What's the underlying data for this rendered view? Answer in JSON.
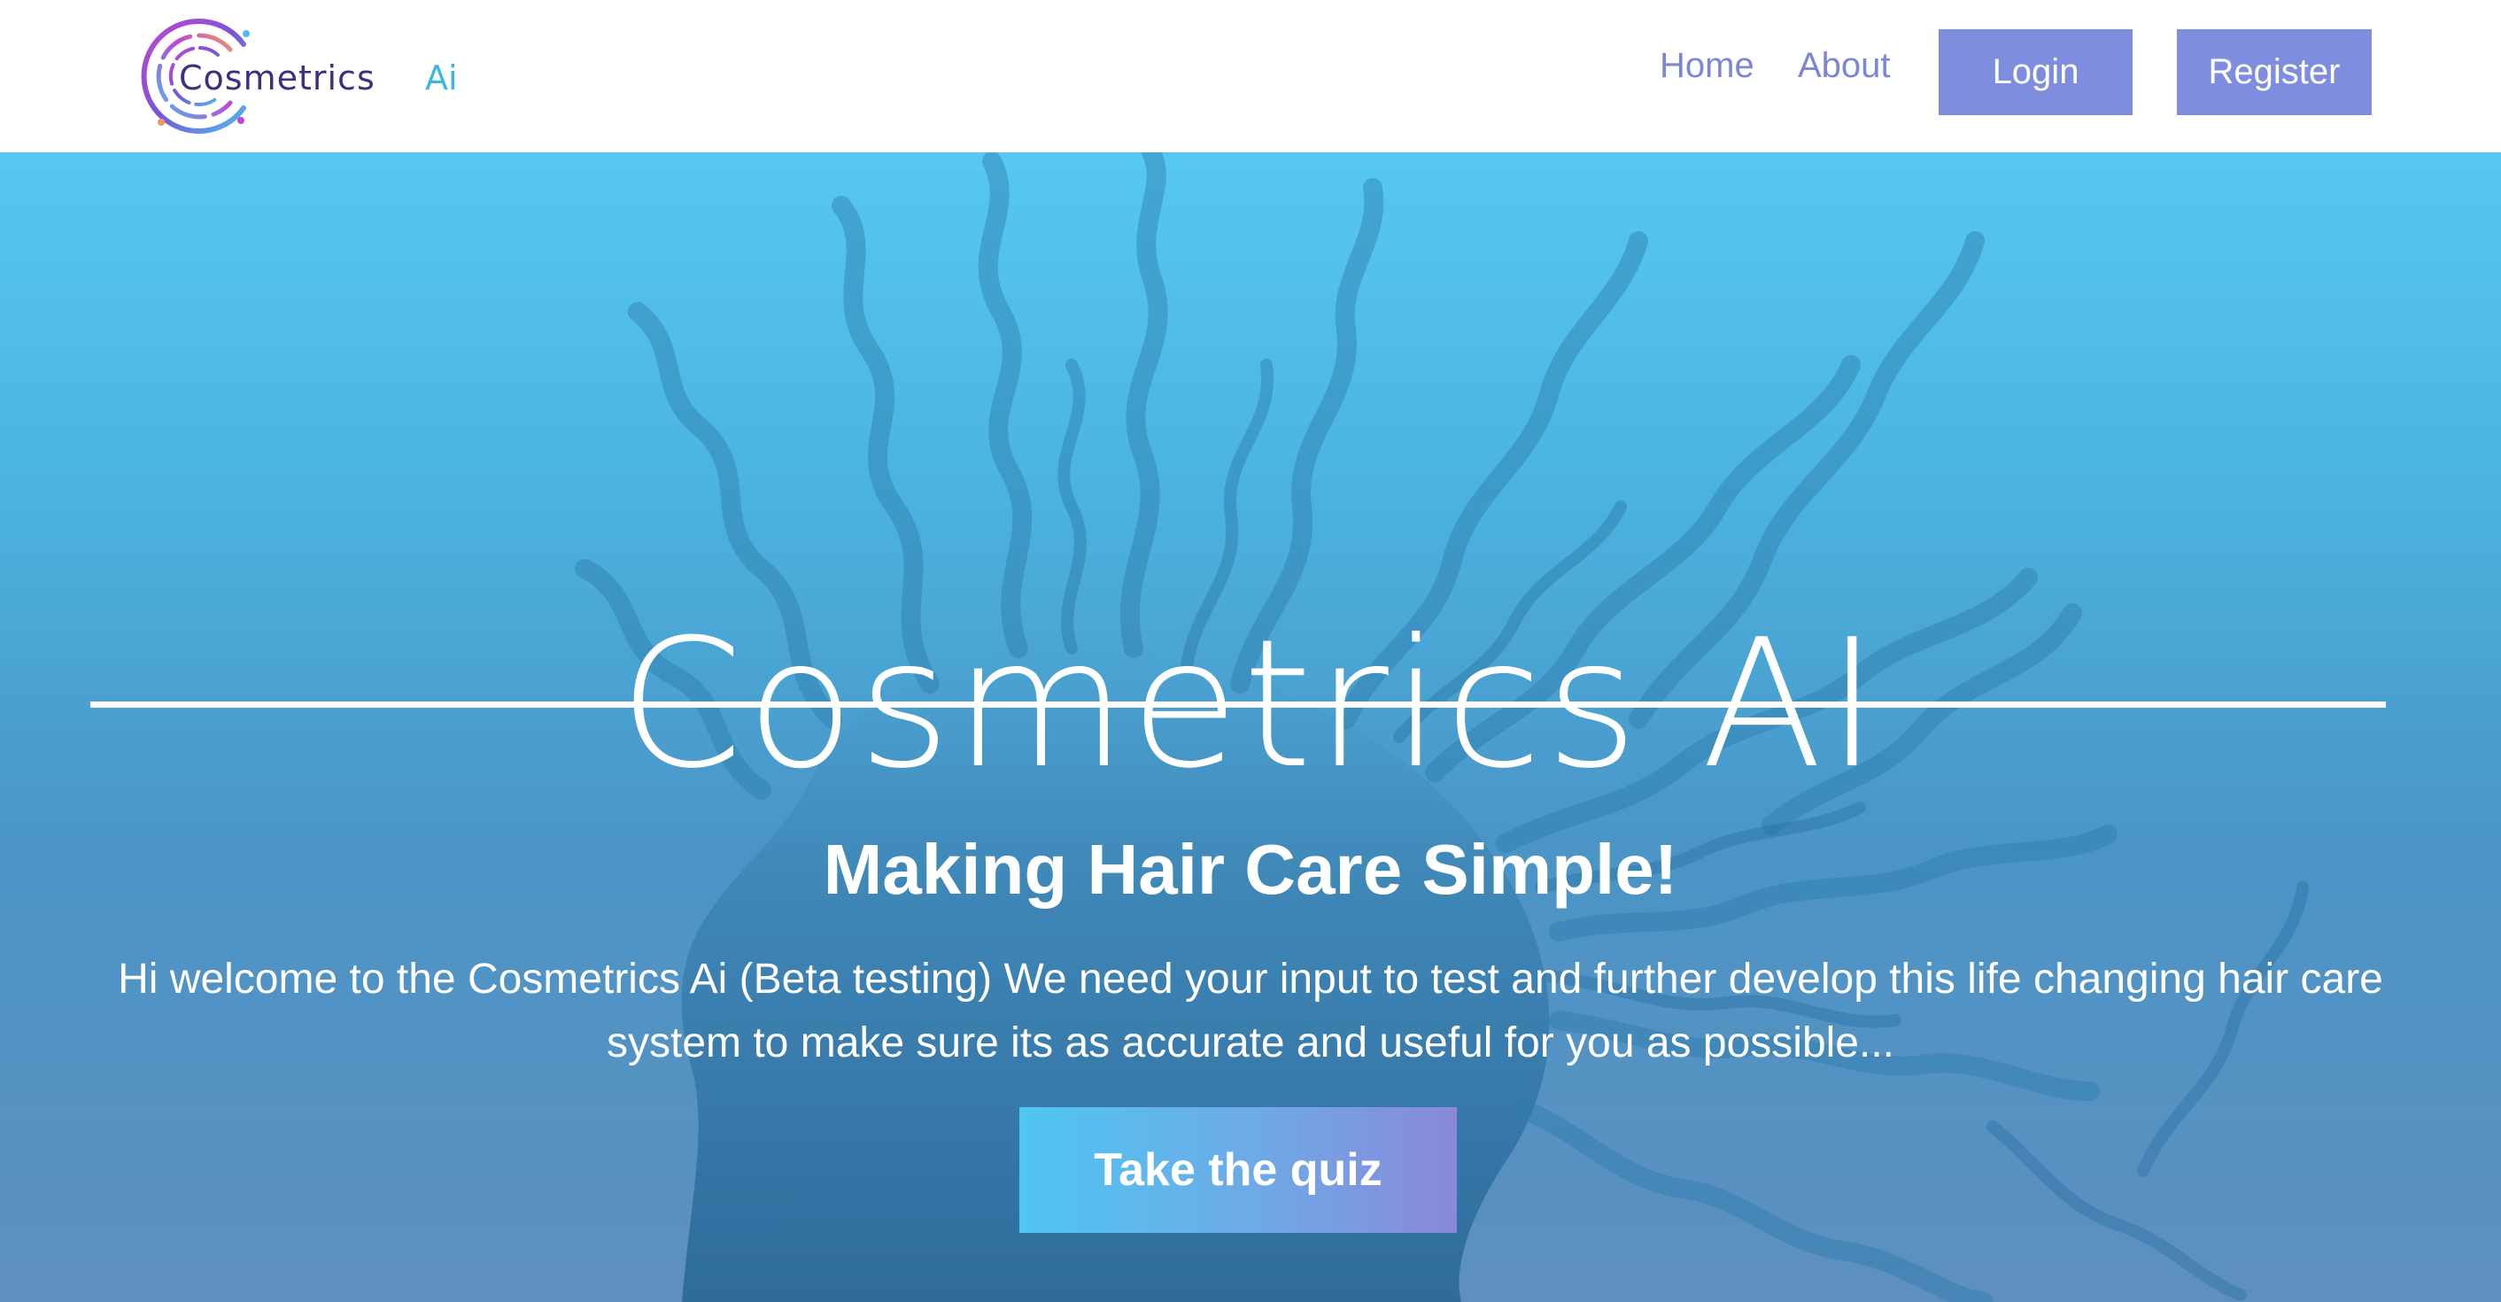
{
  "brand": {
    "logo_text": "Cosmetrics",
    "logo_suffix": "Ai",
    "colors": {
      "logo_text": "#3f2f7f",
      "logo_suffix": "#3cb7e3",
      "ring_start": "#c145d6",
      "ring_end": "#4fb9f0"
    }
  },
  "nav": {
    "links": [
      {
        "label": "Home"
      },
      {
        "label": "About"
      }
    ],
    "login_label": "Login",
    "register_label": "Register",
    "link_color": "#7b86d6",
    "button_color": "#7f8ddf"
  },
  "hero": {
    "title": "Cosmetrics AI",
    "subtitle": "Making Hair Care Simple!",
    "body": "Hi welcome to the Cosmetrics Ai (Beta testing) We need your input to test and further develop this life changing hair care system to make sure its as accurate and useful for you as possible...",
    "cta_label": "Take the quiz",
    "background_color": "#56c8f2"
  }
}
